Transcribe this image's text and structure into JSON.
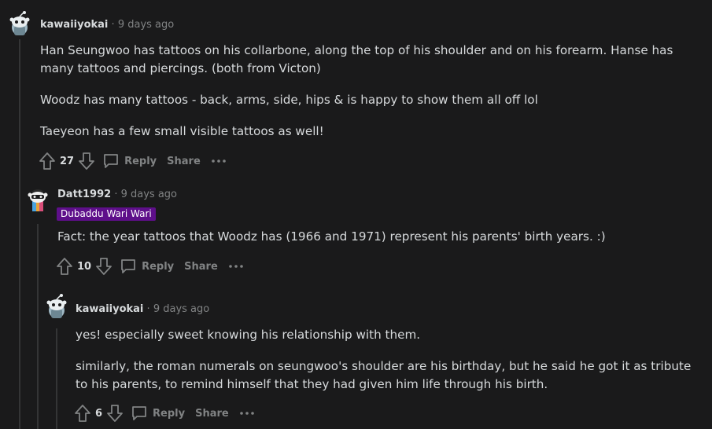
{
  "comments": [
    {
      "author": "kawaiiyokai",
      "separator": "·",
      "time": "9 days ago",
      "flair": "",
      "paragraphs": [
        "Han Seungwoo has tattoos on his collarbone, along the top of his shoulder and on his forearm. Hanse has many tattoos and piercings. (both from Victon)",
        "Woodz has many tattoos - back, arms, side, hips & is happy to show them all off lol",
        "Taeyeon has a few small visible tattoos as well!"
      ],
      "score": "27",
      "reply_label": "Reply",
      "share_label": "Share"
    },
    {
      "author": "Datt1992",
      "separator": "·",
      "time": "9 days ago",
      "flair": "Dubaddu Wari Wari",
      "paragraphs": [
        "Fact: the year tattoos that Woodz has (1966 and 1971) represent his parents' birth years. :)"
      ],
      "score": "10",
      "reply_label": "Reply",
      "share_label": "Share"
    },
    {
      "author": "kawaiiyokai",
      "separator": "·",
      "time": "9 days ago",
      "flair": "",
      "paragraphs": [
        "yes! especially sweet knowing his relationship with them.",
        "similarly, the roman numerals on seungwoo's shoulder are his birthday, but he said he got it as tribute to his parents, to remind himself that they had given him life through his birth."
      ],
      "score": "6",
      "reply_label": "Reply",
      "share_label": "Share"
    }
  ],
  "colors": {
    "background": "#1a1a1b",
    "text": "#d7dadc",
    "muted": "#818384",
    "flair_bg": "#5e0f8a",
    "thread_line": "#343536"
  }
}
